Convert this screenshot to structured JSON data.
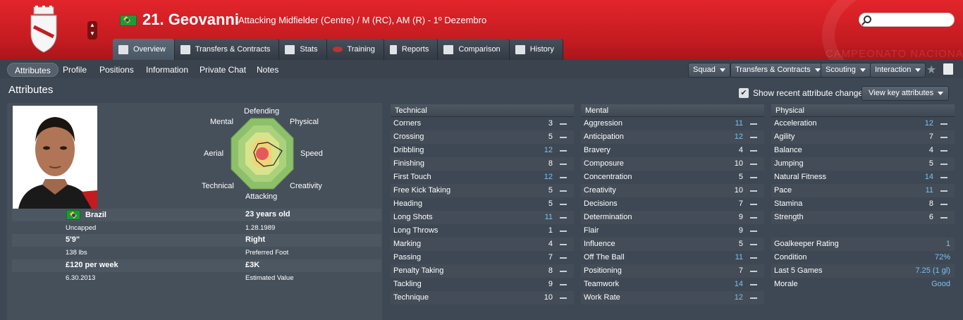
{
  "header": {
    "player_name": "21. Geovanni",
    "positions": "Attacking Midfielder (Centre) / M (RC), AM (R) - 1º Dezembro",
    "watermark": "CAMPEONATO NACIONAL",
    "search_placeholder": ""
  },
  "tabs": [
    {
      "label": "Overview",
      "icon": "overview-icon"
    },
    {
      "label": "Transfers & Contracts",
      "icon": "contract-icon"
    },
    {
      "label": "Stats",
      "icon": "stats-icon"
    },
    {
      "label": "Training",
      "icon": "training-icon"
    },
    {
      "label": "Reports",
      "icon": "reports-icon"
    },
    {
      "label": "Comparison",
      "icon": "comparison-icon"
    },
    {
      "label": "History",
      "icon": "history-icon"
    }
  ],
  "subnav": [
    "Attributes",
    "Profile",
    "Positions",
    "Information",
    "Private Chat",
    "Notes"
  ],
  "actions": [
    "Squad",
    "Transfers & Contracts",
    "Scouting",
    "Interaction"
  ],
  "section_title": "Attributes",
  "show_recent": "Show recent attribute changes",
  "view_key": "View key attributes",
  "radar": {
    "top": "Defending",
    "tl": "Mental",
    "tr": "Physical",
    "l": "Aerial",
    "r": "Speed",
    "bl": "Technical",
    "br": "Creativity",
    "bottom": "Attacking"
  },
  "info": {
    "nation": "Brazil",
    "caps": "Uncapped",
    "age": "23 years old",
    "dob": "1.28.1989",
    "height": "5'9\"",
    "weight": "138 lbs",
    "foot": "Right",
    "foot_label": "Preferred Foot",
    "wage": "£120 per week",
    "contract": "6.30.2013",
    "value": "£3K",
    "value_label": "Estimated Value"
  },
  "technical": {
    "title": "Technical",
    "rows": [
      [
        "Corners",
        "3"
      ],
      [
        "Crossing",
        "5"
      ],
      [
        "Dribbling",
        "12"
      ],
      [
        "Finishing",
        "8"
      ],
      [
        "First Touch",
        "12"
      ],
      [
        "Free Kick Taking",
        "5"
      ],
      [
        "Heading",
        "5"
      ],
      [
        "Long Shots",
        "11"
      ],
      [
        "Long Throws",
        "1"
      ],
      [
        "Marking",
        "4"
      ],
      [
        "Passing",
        "7"
      ],
      [
        "Penalty Taking",
        "8"
      ],
      [
        "Tackling",
        "9"
      ],
      [
        "Technique",
        "10"
      ]
    ]
  },
  "mental": {
    "title": "Mental",
    "rows": [
      [
        "Aggression",
        "11"
      ],
      [
        "Anticipation",
        "12"
      ],
      [
        "Bravery",
        "4"
      ],
      [
        "Composure",
        "10"
      ],
      [
        "Concentration",
        "5"
      ],
      [
        "Creativity",
        "10"
      ],
      [
        "Decisions",
        "7"
      ],
      [
        "Determination",
        "9"
      ],
      [
        "Flair",
        "9"
      ],
      [
        "Influence",
        "5"
      ],
      [
        "Off The Ball",
        "11"
      ],
      [
        "Positioning",
        "7"
      ],
      [
        "Teamwork",
        "14"
      ],
      [
        "Work Rate",
        "12"
      ]
    ]
  },
  "physical": {
    "title": "Physical",
    "rows": [
      [
        "Acceleration",
        "12"
      ],
      [
        "Agility",
        "7"
      ],
      [
        "Balance",
        "4"
      ],
      [
        "Jumping",
        "5"
      ],
      [
        "Natural Fitness",
        "14"
      ],
      [
        "Pace",
        "11"
      ],
      [
        "Stamina",
        "8"
      ],
      [
        "Strength",
        "6"
      ]
    ]
  },
  "extra": [
    [
      "Goalkeeper Rating",
      "1"
    ],
    [
      "Condition",
      "72%"
    ],
    [
      "Last 5 Games",
      "7.25 (1 gl)"
    ],
    [
      "Morale",
      "Good"
    ]
  ]
}
